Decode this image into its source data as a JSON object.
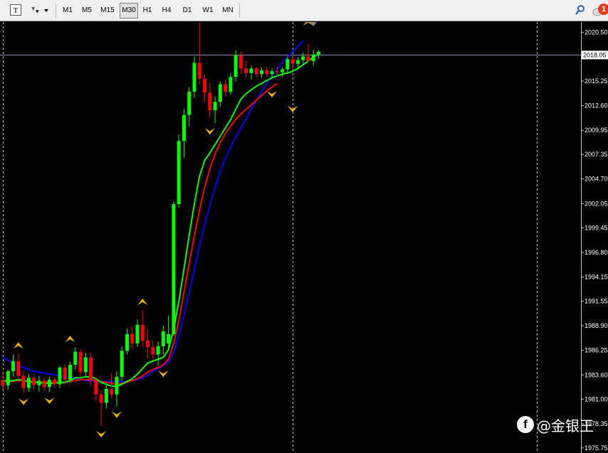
{
  "toolbar": {
    "timeframes": [
      "M1",
      "M5",
      "M15",
      "M30",
      "H1",
      "H4",
      "D1",
      "W1",
      "MN"
    ],
    "active": "M30",
    "notification_count": "1"
  },
  "watermark": {
    "logo": "f",
    "text": "@金银王"
  },
  "chart_data": {
    "type": "candlestick",
    "ylim": [
      1975.2,
      2021.6
    ],
    "y_ticks": [
      "2020.50",
      "2017.90",
      "2015.25",
      "2012.60",
      "2009.95",
      "2007.35",
      "2004.70",
      "2002.05",
      "1999.45",
      "1996.80",
      "1994.15",
      "1991.55",
      "1988.90",
      "1986.25",
      "1983.60",
      "1981.00",
      "1978.35",
      "1975.75"
    ],
    "current_price": "2018.05",
    "candles": [
      [
        1983.0,
        1984.0,
        1982.0,
        1982.5
      ],
      [
        1982.5,
        1984.2,
        1982.0,
        1984.0
      ],
      [
        1984.0,
        1985.8,
        1983.4,
        1985.1
      ],
      [
        1985.1,
        1985.9,
        1983.0,
        1983.5
      ],
      [
        1983.5,
        1984.0,
        1981.6,
        1982.2
      ],
      [
        1982.2,
        1983.7,
        1981.8,
        1983.3
      ],
      [
        1983.3,
        1983.6,
        1982.0,
        1982.5
      ],
      [
        1982.5,
        1983.5,
        1981.8,
        1983.0
      ],
      [
        1983.0,
        1983.3,
        1981.9,
        1982.3
      ],
      [
        1982.3,
        1983.4,
        1981.7,
        1983.1
      ],
      [
        1983.1,
        1983.4,
        1982.2,
        1982.6
      ],
      [
        1982.6,
        1984.6,
        1982.2,
        1984.4
      ],
      [
        1984.4,
        1984.8,
        1982.6,
        1983.1
      ],
      [
        1983.1,
        1985.0,
        1982.8,
        1984.7
      ],
      [
        1984.7,
        1986.6,
        1984.2,
        1986.1
      ],
      [
        1986.1,
        1986.4,
        1983.3,
        1983.9
      ],
      [
        1983.9,
        1986.0,
        1983.5,
        1985.5
      ],
      [
        1985.5,
        1986.0,
        1982.4,
        1983.0
      ],
      [
        1983.0,
        1983.4,
        1980.8,
        1981.5
      ],
      [
        1981.5,
        1982.0,
        1978.1,
        1980.6
      ],
      [
        1980.6,
        1982.5,
        1980.0,
        1982.1
      ],
      [
        1982.1,
        1983.8,
        1981.0,
        1981.5
      ],
      [
        1981.5,
        1984.0,
        1980.2,
        1983.4
      ],
      [
        1983.4,
        1986.7,
        1983.0,
        1986.2
      ],
      [
        1986.2,
        1988.6,
        1985.8,
        1988.0
      ],
      [
        1988.0,
        1988.8,
        1986.5,
        1987.0
      ],
      [
        1987.0,
        1989.6,
        1986.6,
        1989.0
      ],
      [
        1989.0,
        1990.6,
        1986.6,
        1987.3
      ],
      [
        1987.3,
        1988.5,
        1985.4,
        1986.6
      ],
      [
        1986.6,
        1987.3,
        1985.2,
        1985.8
      ],
      [
        1985.8,
        1987.2,
        1984.6,
        1986.7
      ],
      [
        1986.7,
        1988.9,
        1985.8,
        1988.3
      ],
      [
        1987.0,
        1990.0,
        1986.5,
        1988.0
      ],
      [
        1988.0,
        2002.3,
        1987.8,
        2002.0
      ],
      [
        2002.0,
        2009.5,
        2001.6,
        2008.8
      ],
      [
        2008.8,
        2012.2,
        2007.0,
        2011.6
      ],
      [
        2011.6,
        2014.6,
        2010.4,
        2014.1
      ],
      [
        2014.1,
        2017.9,
        2013.4,
        2017.2
      ],
      [
        2017.2,
        2021.7,
        2014.9,
        2015.5
      ],
      [
        2015.5,
        2016.0,
        2013.0,
        2014.0
      ],
      [
        2014.0,
        2015.1,
        2011.3,
        2012.1
      ],
      [
        2012.1,
        2013.6,
        2010.7,
        2013.0
      ],
      [
        2013.0,
        2015.2,
        2012.5,
        2014.9
      ],
      [
        2014.9,
        2015.4,
        2013.6,
        2014.1
      ],
      [
        2014.1,
        2016.1,
        2013.8,
        2015.7
      ],
      [
        2015.7,
        2018.6,
        2015.2,
        2018.0
      ],
      [
        2018.0,
        2018.4,
        2016.0,
        2016.6
      ],
      [
        2016.6,
        2017.4,
        2015.6,
        2016.1
      ],
      [
        2016.1,
        2016.9,
        2015.4,
        2016.6
      ],
      [
        2016.6,
        2016.8,
        2015.6,
        2016.0
      ],
      [
        2016.0,
        2016.7,
        2015.6,
        2016.4
      ],
      [
        2016.4,
        2016.8,
        2015.7,
        2016.0
      ],
      [
        2016.0,
        2016.6,
        2015.6,
        2016.3
      ],
      [
        2016.3,
        2016.8,
        2015.8,
        2016.2
      ],
      [
        2016.2,
        2016.7,
        2015.7,
        2016.5
      ],
      [
        2016.5,
        2017.9,
        2016.1,
        2017.6
      ],
      [
        2017.6,
        2017.9,
        2016.6,
        2017.1
      ],
      [
        2017.1,
        2017.8,
        2016.5,
        2017.5
      ],
      [
        2017.5,
        2018.3,
        2016.9,
        2017.9
      ],
      [
        2017.9,
        2019.2,
        2017.3,
        2017.4
      ],
      [
        2017.4,
        2018.6,
        2016.9,
        2018.1
      ],
      [
        2018.1,
        2018.6,
        2017.6,
        2018.4
      ]
    ],
    "ma_green": [
      1983.0,
      1982.9,
      1983.0,
      1983.1,
      1983.0,
      1982.9,
      1982.8,
      1982.8,
      1982.7,
      1982.7,
      1982.7,
      1982.8,
      1982.8,
      1983.0,
      1983.3,
      1983.3,
      1983.4,
      1983.4,
      1983.2,
      1982.8,
      1982.6,
      1982.4,
      1982.4,
      1982.6,
      1982.9,
      1983.2,
      1983.7,
      1984.3,
      1984.9,
      1985.1,
      1985.3,
      1985.5,
      1986.3,
      1988.5,
      1991.5,
      1995.0,
      1998.6,
      2002.0,
      2005.0,
      2006.7,
      2007.5,
      2008.4,
      2009.3,
      2010.2,
      2011.1,
      2012.2,
      2013.3,
      2013.9,
      2014.3,
      2014.7,
      2015.0,
      2015.3,
      2015.6,
      2015.8,
      2016.0,
      2016.1,
      2016.3,
      2016.6,
      2017.0,
      2017.4,
      2017.8,
      2018.2
    ],
    "ma_red": [
      1983.0,
      1982.9,
      1982.9,
      1983.0,
      1983.0,
      1982.9,
      1982.9,
      1982.8,
      1982.8,
      1982.8,
      1982.8,
      1982.8,
      1982.8,
      1982.9,
      1983.0,
      1983.1,
      1983.1,
      1983.1,
      1983.0,
      1982.9,
      1982.8,
      1982.7,
      1982.6,
      1982.7,
      1982.8,
      1983.0,
      1983.2,
      1983.5,
      1983.9,
      1984.2,
      1984.4,
      1984.7,
      1985.3,
      1987.0,
      1989.5,
      1992.5,
      1995.6,
      1998.6,
      2001.4,
      2003.8,
      2005.8,
      2007.4,
      2008.6,
      2009.6,
      2010.4,
      2011.1,
      2011.7,
      2012.2,
      2012.7,
      2013.2,
      2013.7,
      2014.2,
      2014.6,
      2015.0
    ],
    "ma_blue": [
      1985.5,
      1985.2,
      1984.9,
      1984.6,
      1984.4,
      1984.2,
      1984.0,
      1983.9,
      1983.8,
      1983.7,
      1983.6,
      1983.5,
      1983.4,
      1983.3,
      1983.2,
      1983.1,
      1983.0,
      1983.0,
      1982.9,
      1982.9,
      1982.9,
      1982.9,
      1982.9,
      1982.9,
      1982.9,
      1983.0,
      1983.1,
      1983.3,
      1983.6,
      1984.0,
      1984.3,
      1984.6,
      1985.0,
      1986.0,
      1987.8,
      1990.0,
      1992.4,
      1995.0,
      1997.5,
      1999.8,
      2001.9,
      2003.8,
      2005.5,
      2006.9,
      2008.1,
      2009.2,
      2010.2,
      2011.2,
      2012.2,
      2013.2,
      2014.1,
      2015.0,
      2015.8,
      2016.5,
      2017.2,
      2017.8,
      2018.4,
      2019.0,
      2019.6
    ],
    "up_color": "#00ff00",
    "down_color": "#ff0000",
    "ma_colors": [
      "#00ff00",
      "#ff0000",
      "#0000ff"
    ],
    "fractal_up": [
      [
        3,
        1985.9
      ],
      [
        13,
        1986.6
      ],
      [
        27,
        1990.6
      ],
      [
        38,
        2021.7
      ],
      [
        46,
        2021.5
      ],
      [
        59,
        2020.7
      ]
    ],
    "fractal_down": [
      [
        4,
        1981.6
      ],
      [
        9,
        1981.7
      ],
      [
        19,
        1978.1
      ],
      [
        22,
        1980.2
      ],
      [
        31,
        1984.6
      ],
      [
        40,
        2010.7
      ],
      [
        52,
        2014.7
      ],
      [
        56,
        2013.1
      ]
    ],
    "vgrid_candles": [
      0,
      56
    ]
  }
}
